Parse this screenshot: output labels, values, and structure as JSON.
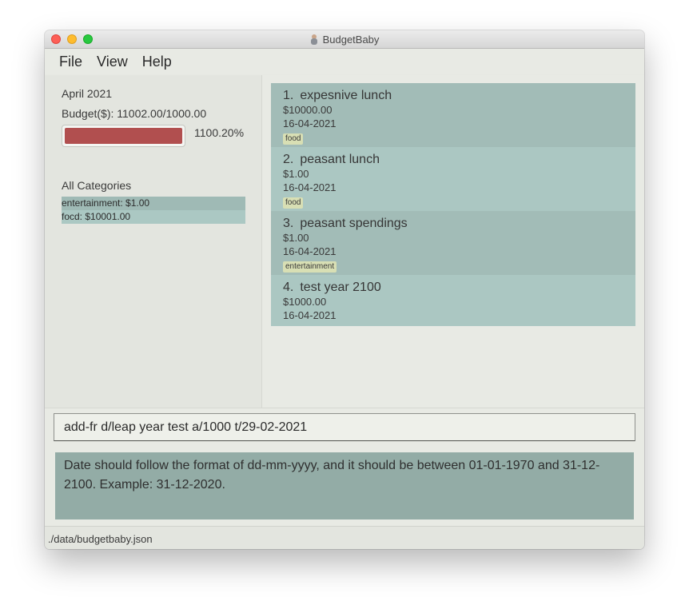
{
  "window": {
    "title": "BudgetBaby"
  },
  "menu": {
    "items": [
      "File",
      "View",
      "Help"
    ]
  },
  "budget_panel": {
    "month": "April 2021",
    "budget_text": "Budget($): 11002.00/1000.00",
    "progress_percent_text": "1100.20%",
    "progress_value_percent": 1100.2,
    "progress_bar_color": "#b14f4f",
    "categories_title": "All Categories",
    "categories": [
      "entertainment: $1.00",
      "focd: $10001.00"
    ]
  },
  "financial_records": [
    {
      "index": "1.",
      "description": "expesnive lunch",
      "amount": "$10000.00",
      "date": "16-04-2021",
      "tag": "food"
    },
    {
      "index": "2.",
      "description": "peasant lunch",
      "amount": "$1.00",
      "date": "16-04-2021",
      "tag": "food"
    },
    {
      "index": "3.",
      "description": "peasant spendings",
      "amount": "$1.00",
      "date": "16-04-2021",
      "tag": "entertainment"
    },
    {
      "index": "4.",
      "description": "test year 2100",
      "amount": "$1000.00",
      "date": "16-04-2021",
      "tag": ""
    }
  ],
  "command": {
    "value": "add-fr d/leap year test a/1000 t/29-02-2021"
  },
  "result": {
    "text": "Date should follow the format of dd-mm-yyyy, and it should be between 01-01-1970 and 31-12-2100. Example: 31-12-2020."
  },
  "status": {
    "file_path": "./data/budgetbaby.json"
  },
  "colors": {
    "row_dark": "#a2bcb7",
    "row_light": "#abc7c2",
    "tag_background": "#d8dfb4",
    "result_background": "#93aca6"
  }
}
